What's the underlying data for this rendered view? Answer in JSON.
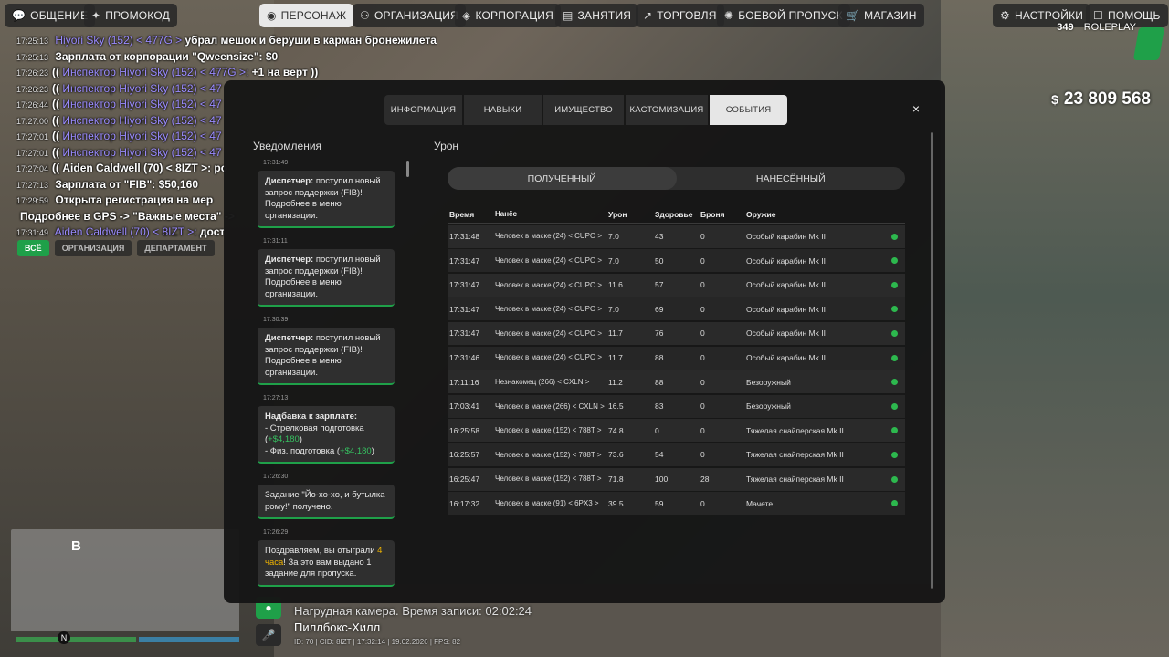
{
  "topbar": {
    "left": [
      {
        "icon": "chat-icon",
        "label": "ОБЩЕНИЕ"
      },
      {
        "icon": "gift-icon",
        "label": "ПРОМОКОД"
      },
      {
        "icon": "person-icon",
        "label": "ПЕРСОНАЖ",
        "active": true
      },
      {
        "icon": "org-icon",
        "label": "ОРГАНИЗАЦИЯ"
      },
      {
        "icon": "corp-icon",
        "label": "КОРПОРАЦИЯ"
      },
      {
        "icon": "book-icon",
        "label": "ЗАНЯТИЯ"
      },
      {
        "icon": "chart-icon",
        "label": "ТОРГОВЛЯ"
      },
      {
        "icon": "battlepass-icon",
        "label": "БОЕВОЙ ПРОПУСК"
      },
      {
        "icon": "cart-icon",
        "label": "МАГАЗИН"
      }
    ],
    "right": [
      {
        "icon": "gear-icon",
        "label": "НАСТРОЙКИ"
      },
      {
        "icon": "help-icon",
        "label": "ПОМОЩЬ"
      }
    ]
  },
  "chat": {
    "lines": [
      {
        "time": "17:25:13",
        "prefix": "",
        "name": "Hiyori Sky (152) < 477G >",
        "text": "убрал мешок и беруши в карман бронежилета"
      },
      {
        "time": "17:25:13",
        "prefix": "",
        "name": "",
        "text": "Зарплата от корпорации \"Qweensize\": $0"
      },
      {
        "time": "17:26:23",
        "prefix": "((",
        "name": "Инспектор Hiyori Sky (152) < 477G >:",
        "text": "+1 на верт ))"
      },
      {
        "time": "17:26:23",
        "prefix": "((",
        "name": "Инспектор Hiyori Sky (152) < 47",
        "text": ""
      },
      {
        "time": "17:26:44",
        "prefix": "((",
        "name": "Инспектор Hiyori Sky (152) < 47",
        "text": ""
      },
      {
        "time": "17:27:00",
        "prefix": "((",
        "name": "Инспектор Hiyori Sky (152) < 47",
        "text": ""
      },
      {
        "time": "17:27:01",
        "prefix": "((",
        "name": "Инспектор Hiyori Sky (152) < 47",
        "text": ""
      },
      {
        "time": "17:27:01",
        "prefix": "((",
        "name": "Инспектор Hiyori Sky (152) < 47",
        "text": ""
      },
      {
        "time": "17:27:04",
        "prefix": "((",
        "name": "",
        "text": "Aiden Caldwell (70) < 8IZT >: ро"
      },
      {
        "time": "17:27:13",
        "prefix": "",
        "name": "",
        "text": "Зарплата от \"FIB\": $50,160"
      },
      {
        "time": "17:29:59",
        "prefix": "",
        "name": "",
        "text": "Открыта регистрация на мер"
      },
      {
        "time": "",
        "prefix": "",
        "name": "",
        "text": "Подробнее в GPS -> \"Важные места\" ->"
      },
      {
        "time": "17:31:49",
        "prefix": "",
        "name": "Aiden Caldwell (70) < 8IZT >:",
        "text": "дост"
      }
    ],
    "tabs": [
      "ВСЁ",
      "ОРГАНИЗАЦИЯ",
      "ДЕПАРТАМЕНТ"
    ]
  },
  "hud": {
    "online": "349",
    "server": "ROLEPLAY",
    "money_symbol": "$",
    "money": "23 809 568",
    "minimap_letter": "B",
    "minimap_north": "N",
    "cam_text": "Нагрудная камера. Время записи: 02:02:24",
    "location": "Пиллбокс-Хилл",
    "id_line": "ID: 70 | CID: 8IZT | 17:32:14 | 19.02.2026 | FPS: 82"
  },
  "modal": {
    "tabs": [
      "ИНФОРМАЦИЯ",
      "НАВЫКИ",
      "ИМУЩЕСТВО",
      "КАСТОМИЗАЦИЯ",
      "СОБЫТИЯ"
    ],
    "active_tab": "СОБЫТИЯ",
    "close": "×",
    "notifications_title": "Уведомления",
    "notifications": [
      {
        "time": "17:31:49",
        "html": "<b>Диспетчер:</b> поступил новый запрос поддержки (FIB)! Подробнее в меню организации."
      },
      {
        "time": "17:31:11",
        "html": "<b>Диспетчер:</b> поступил новый запрос поддержки (FIB)! Подробнее в меню организации."
      },
      {
        "time": "17:30:39",
        "html": "<b>Диспетчер:</b> поступил новый запрос поддержки (FIB)! Подробнее в меню организации."
      },
      {
        "time": "17:27:13",
        "html": "<b>Надбавка к зарплате:</b><br>- Стрелковая подготовка (<span class='green'>+$4,180</span>)<br>- Физ. подготовка (<span class='green'>+$4,180</span>)"
      },
      {
        "time": "17:26:30",
        "html": "Задание \"Йо-хо-хо, и бутылка рому!\" получено."
      },
      {
        "time": "17:26:29",
        "html": "Поздравляем, вы отыграли <span class='yellow'>4 часа</span>! За это вам выдано 1 задание для пропуска."
      }
    ],
    "damage_title": "Урон",
    "switch": [
      "ПОЛУЧЕННЫЙ",
      "НАНЕСЁННЫЙ"
    ],
    "columns": [
      "Время",
      "Нанёс",
      "Урон",
      "Здоровье",
      "Броня",
      "Оружие"
    ],
    "rows": [
      [
        "17:31:48",
        "Человек в маске (24) < CUPO >",
        "7.0",
        "43",
        "0",
        "Особый карабин Mk II"
      ],
      [
        "17:31:47",
        "Человек в маске (24) < CUPO >",
        "7.0",
        "50",
        "0",
        "Особый карабин Mk II"
      ],
      [
        "17:31:47",
        "Человек в маске (24) < CUPO >",
        "11.6",
        "57",
        "0",
        "Особый карабин Mk II"
      ],
      [
        "17:31:47",
        "Человек в маске (24) < CUPO >",
        "7.0",
        "69",
        "0",
        "Особый карабин Mk II"
      ],
      [
        "17:31:47",
        "Человек в маске (24) < CUPO >",
        "11.7",
        "76",
        "0",
        "Особый карабин Mk II"
      ],
      [
        "17:31:46",
        "Человек в маске (24) < CUPO >",
        "11.7",
        "88",
        "0",
        "Особый карабин Mk II"
      ],
      [
        "17:11:16",
        "Незнакомец (266) < CXLN >",
        "11.2",
        "88",
        "0",
        "Безоружный"
      ],
      [
        "17:03:41",
        "Человек в маске (266) < CXLN >",
        "16.5",
        "83",
        "0",
        "Безоружный"
      ],
      [
        "16:25:58",
        "Человек в маске (152) < 788T >",
        "74.8",
        "0",
        "0",
        "Тяжелая снайперская Mk II"
      ],
      [
        "16:25:57",
        "Человек в маске (152) < 788T >",
        "73.6",
        "54",
        "0",
        "Тяжелая снайперская Mk II"
      ],
      [
        "16:25:47",
        "Человек в маске (152) < 788T >",
        "71.8",
        "100",
        "28",
        "Тяжелая снайперская Mk II"
      ],
      [
        "16:17:32",
        "Человек в маске (91) < 6PX3 >",
        "39.5",
        "59",
        "0",
        "Мачете"
      ]
    ]
  },
  "colors": {
    "accent": "#1fa049",
    "panel": "#161616",
    "row": "#2a2a2a"
  }
}
